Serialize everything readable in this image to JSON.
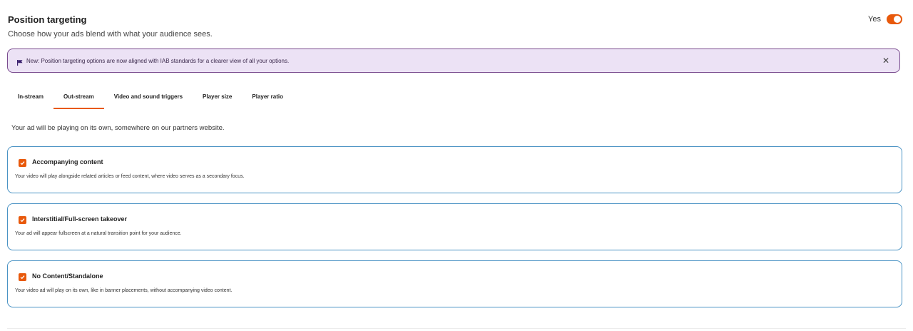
{
  "header": {
    "title": "Position targeting",
    "subtitle": "Choose how your ads blend with what your audience sees.",
    "toggle_label": "Yes",
    "toggle_on": true
  },
  "banner": {
    "text": "New: Position targeting options are now aligned with IAB standards for a clearer view of all your options.",
    "icon": "flag-icon",
    "close_icon": "close-icon"
  },
  "tabs": [
    {
      "label": "In-stream",
      "active": false
    },
    {
      "label": "Out-stream",
      "active": true
    },
    {
      "label": "Video and sound triggers",
      "active": false
    },
    {
      "label": "Player size",
      "active": false
    },
    {
      "label": "Player ratio",
      "active": false
    }
  ],
  "intro": "Your ad will be playing on its own, somewhere on our partners website.",
  "options": [
    {
      "title": "Accompanying content",
      "description": "Your video will play alongside related articles or feed content, where video serves as a secondary focus.",
      "checked": true
    },
    {
      "title": "Interstitial/Full-screen takeover",
      "description": "Your ad will appear fullscreen at a natural transition point for your audience.",
      "checked": true
    },
    {
      "title": "No Content/Standalone",
      "description": "Your video ad will play on its own, like in banner placements, without accompanying video content.",
      "checked": true
    }
  ],
  "colors": {
    "accent": "#e8590c",
    "banner_bg": "#ece2f5",
    "banner_border": "#7a4c8f",
    "card_border": "#4a93c4"
  }
}
